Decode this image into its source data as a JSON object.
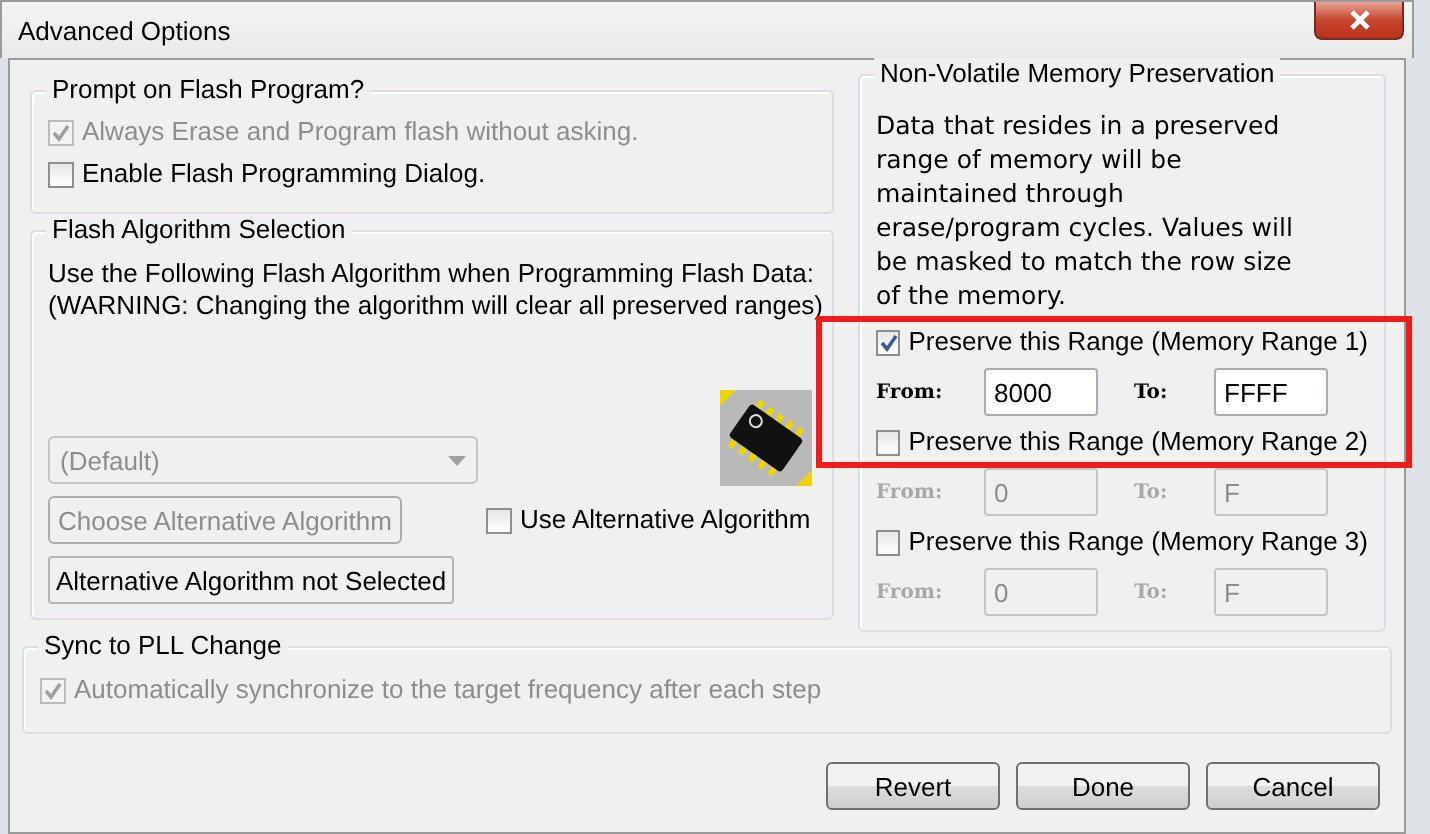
{
  "window": {
    "title": "Advanced Options"
  },
  "prompt_group": {
    "title": "Prompt on Flash Program?",
    "options": [
      {
        "label": "Always Erase and Program flash without asking.",
        "checked": true,
        "disabled": true
      },
      {
        "label": "Enable Flash Programming Dialog.",
        "checked": false,
        "disabled": false
      }
    ]
  },
  "algorithm_group": {
    "title": "Flash Algorithm Selection",
    "description": "Use the Following Flash Algorithm when Programming Flash Data:",
    "warning": "(WARNING: Changing the algorithm will clear all preserved ranges)",
    "dropdown": {
      "value": "(Default)",
      "disabled": true
    },
    "choose_button": {
      "label": "Choose Alternative Algorithm",
      "disabled": true
    },
    "status_field": {
      "value": "Alternative Algorithm not Selected"
    },
    "use_alternative": {
      "label": "Use Alternative Algorithm",
      "checked": false,
      "disabled": false
    }
  },
  "memory_group": {
    "title": "Non-Volatile Memory Preservation",
    "description": "Data that resides in a preserved range of memory will be maintained through erase/program cycles. Values will be masked to match the row size of the memory.",
    "ranges": [
      {
        "label": "Preserve this Range (Memory Range 1)",
        "checked": true,
        "from_label": "From:",
        "from": "8000",
        "to_label": "To:",
        "to": "FFFF"
      },
      {
        "label": "Preserve this Range (Memory Range 2)",
        "checked": false,
        "from_label": "From:",
        "from": "0",
        "to_label": "To:",
        "to": "F"
      },
      {
        "label": "Preserve this Range (Memory Range 3)",
        "checked": false,
        "from_label": "From:",
        "from": "0",
        "to_label": "To:",
        "to": "F"
      }
    ]
  },
  "sync_group": {
    "title": "Sync to PLL Change",
    "option": {
      "label": "Automatically synchronize to the target frequency after each step",
      "checked": true,
      "disabled": true
    }
  },
  "buttons": [
    "Revert",
    "Done",
    "Cancel"
  ]
}
